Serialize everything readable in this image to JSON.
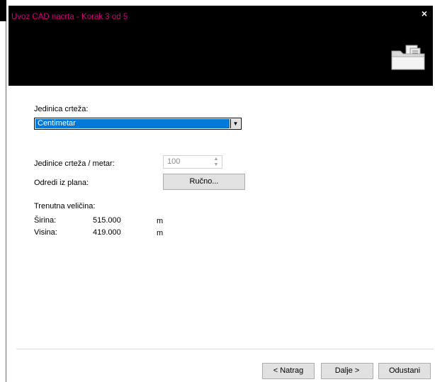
{
  "window": {
    "title": "Uvoz CAD nacrta - Korak 3 od 5",
    "close_glyph": "×"
  },
  "form": {
    "units_label": "Jedinica crteža:",
    "units_select": {
      "selected": "Centimetar"
    },
    "units_per_meter_label": "Jedinice crteža / metar:",
    "units_per_meter_value": "100",
    "determine_label": "Odredi iz plana:",
    "manual_button": "Ručno...",
    "current_size_label": "Trenutna veličina:",
    "width_label": "Širina:",
    "width_value": "515.000",
    "width_unit": "m",
    "height_label": "Visina:",
    "height_value": "419.000",
    "height_unit": "m"
  },
  "footer": {
    "back_button": "< Natrag",
    "next_button": "Dalje >",
    "cancel_button": "Odustani"
  },
  "icons": {
    "close": "close-icon",
    "dropdown": "chevron-down-icon",
    "spin_up": "spin-up-icon",
    "spin_down": "spin-down-icon",
    "header": "folder-icon"
  },
  "colors": {
    "title": "#d4007a",
    "header_bg": "#000000",
    "selection": "#0078d7"
  }
}
